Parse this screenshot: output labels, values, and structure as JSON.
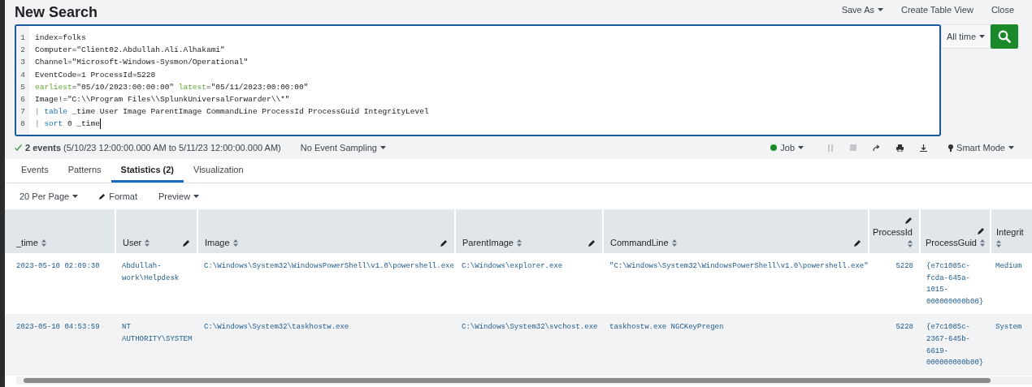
{
  "header": {
    "title": "New Search",
    "actions": [
      {
        "label": "Save As",
        "dropdown": true
      },
      {
        "label": "Create Table View",
        "dropdown": false
      },
      {
        "label": "Close",
        "dropdown": false
      }
    ]
  },
  "query": {
    "lines": [
      [
        {
          "kind": "text",
          "text": "index=folks"
        }
      ],
      [
        {
          "kind": "text",
          "text": "Computer=\"Client02.Abdullah.Ali.Alhakami\""
        }
      ],
      [
        {
          "kind": "text",
          "text": "Channel=\"Microsoft-Windows-Sysmon/Operational\""
        }
      ],
      [
        {
          "kind": "text",
          "text": "EventCode=1 ProcessId=5228"
        }
      ],
      [
        {
          "kind": "modifier",
          "text": "earliest"
        },
        {
          "kind": "text",
          "text": "=\"05/10/2023:00:00:00\" "
        },
        {
          "kind": "modifier",
          "text": "latest"
        },
        {
          "kind": "text",
          "text": "=\"05/11/2023:00:00:00\""
        }
      ],
      [
        {
          "kind": "text",
          "text": "Image!=\"C:\\\\Program Files\\\\SplunkUniversalForwarder\\\\*\""
        }
      ],
      [
        {
          "kind": "pipe",
          "text": "| "
        },
        {
          "kind": "command",
          "text": "table"
        },
        {
          "kind": "text",
          "text": " _time User Image ParentImage CommandLine ProcessId ProcessGuid IntegrityLevel"
        }
      ],
      [
        {
          "kind": "pipe",
          "text": "| "
        },
        {
          "kind": "command",
          "text": "sort"
        },
        {
          "kind": "text",
          "text": " 0 _time"
        }
      ]
    ],
    "line_numbers": [
      "1",
      "2",
      "3",
      "4",
      "5",
      "6",
      "7",
      "8"
    ],
    "time_range": "All time"
  },
  "status": {
    "summary": "**2 events** (5/10/23 12:00:00.000 AM to 5/11/23 12:00:00.000 AM)",
    "sampling": "No Event Sampling",
    "job": "Job",
    "mode": "Smart Mode"
  },
  "tabs": [
    {
      "label": "Events",
      "selected": false
    },
    {
      "label": "Patterns",
      "selected": false
    },
    {
      "label": "Statistics (2)",
      "selected": true
    },
    {
      "label": "Visualization",
      "selected": false
    }
  ],
  "toolbar": {
    "per_page": "20 Per Page",
    "format": "Format",
    "preview": "Preview"
  },
  "table": {
    "columns": [
      {
        "label": "_time",
        "editable": false
      },
      {
        "label": "User",
        "editable": true
      },
      {
        "label": "Image",
        "editable": true
      },
      {
        "label": "ParentImage",
        "editable": true
      },
      {
        "label": "CommandLine",
        "editable": true
      },
      {
        "label": "ProcessId",
        "editable": true
      },
      {
        "label": "ProcessGuid",
        "editable": true
      },
      {
        "label": "Integrit",
        "editable": false
      }
    ],
    "rows": [
      {
        "cells": [
          "2023-05-10 02:09:30",
          "Abdullah-\nwork\\Helpdesk",
          "C:\\Windows\\System32\\WindowsPowerShell\\v1.0\\powershell.exe",
          "C:\\Windows\\explorer.exe",
          "\"C:\\Windows\\System32\\WindowsPowerShell\\v1.0\\powershell.exe\"",
          "5228",
          "{e7c1085c-\nfcda-645a-\n1015-\n000000000b00}",
          "Medium"
        ]
      },
      {
        "cells": [
          "2023-05-10 04:53:59",
          "NT\nAUTHORITY\\SYSTEM",
          "C:\\Windows\\System32\\taskhostw.exe",
          "C:\\Windows\\System32\\svchost.exe",
          "taskhostw.exe NGCKeyPregen",
          "5228",
          "{e7c1085c-\n2367-645b-\n6619-\n000000000b00}",
          "System"
        ]
      }
    ]
  }
}
